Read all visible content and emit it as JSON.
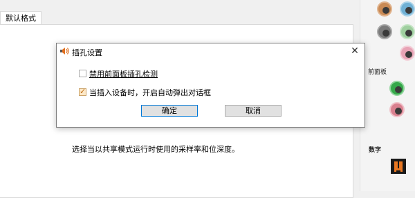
{
  "background": {
    "tab_label": "默认格式",
    "description": "选择当以共享模式运行时使用的采样率和位深度。"
  },
  "right_panel": {
    "front_panel_label": "前面板",
    "digital_label": "数字",
    "jack_colors": [
      "#c98a55",
      "#6fb0d4",
      "#7a7a7a",
      "#9fcf9f",
      "#e8a3b5",
      "#35a84a",
      "#d9808f"
    ]
  },
  "dialog": {
    "title": "插孔设置",
    "close_glyph": "✕",
    "option1": {
      "label": "禁用前面板插孔检测",
      "checked": false
    },
    "option2": {
      "label": "当插入设备时，开启自动弹出对话框",
      "checked": true
    },
    "ok_label": "确定",
    "cancel_label": "取消"
  }
}
